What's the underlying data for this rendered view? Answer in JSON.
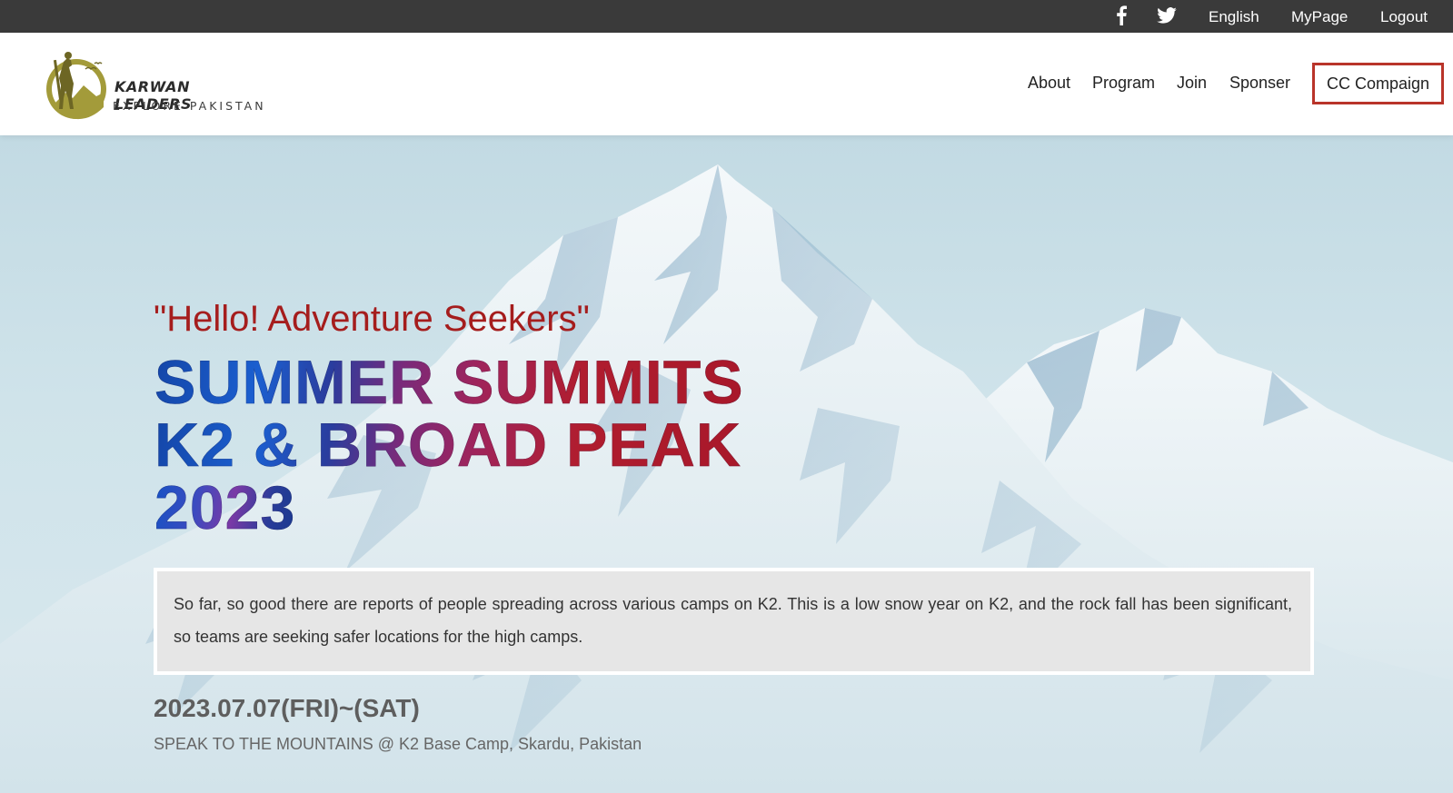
{
  "topbar": {
    "social": [
      {
        "icon": "facebook-icon",
        "glyph": "f"
      },
      {
        "icon": "twitter-icon"
      }
    ],
    "links": {
      "language": "English",
      "mypage": "MyPage",
      "logout": "Logout"
    }
  },
  "header": {
    "logo": {
      "title": "KARWAN LEADERS",
      "subtitle": "EXPLORE PAKISTAN"
    },
    "nav": {
      "about": "About",
      "program": "Program",
      "join": "Join",
      "sponser": "Sponser",
      "cc": "CC Compaign"
    }
  },
  "hero": {
    "greeting": "\"Hello! Adventure Seekers\"",
    "headline": [
      "SUMMER SUMMITS",
      "K2 & BROAD PEAK",
      "2023"
    ],
    "notice": "So far, so good there are reports of people spreading across various camps on K2. This is a low snow year on K2, and the rock fall has been significant, so teams are seeking safer locations for the high camps.",
    "date": "2023.07.07(FRI)~(SAT)",
    "place": "SPEAK TO THE MOUNTAINS @ K2 Base Camp, Skardu, Pakistan"
  },
  "colors": {
    "topbar_bg": "#3a3a3a",
    "accent_red": "#a51d1d",
    "cc_border": "#b9342a",
    "logo_olive": "#a39b3a"
  }
}
